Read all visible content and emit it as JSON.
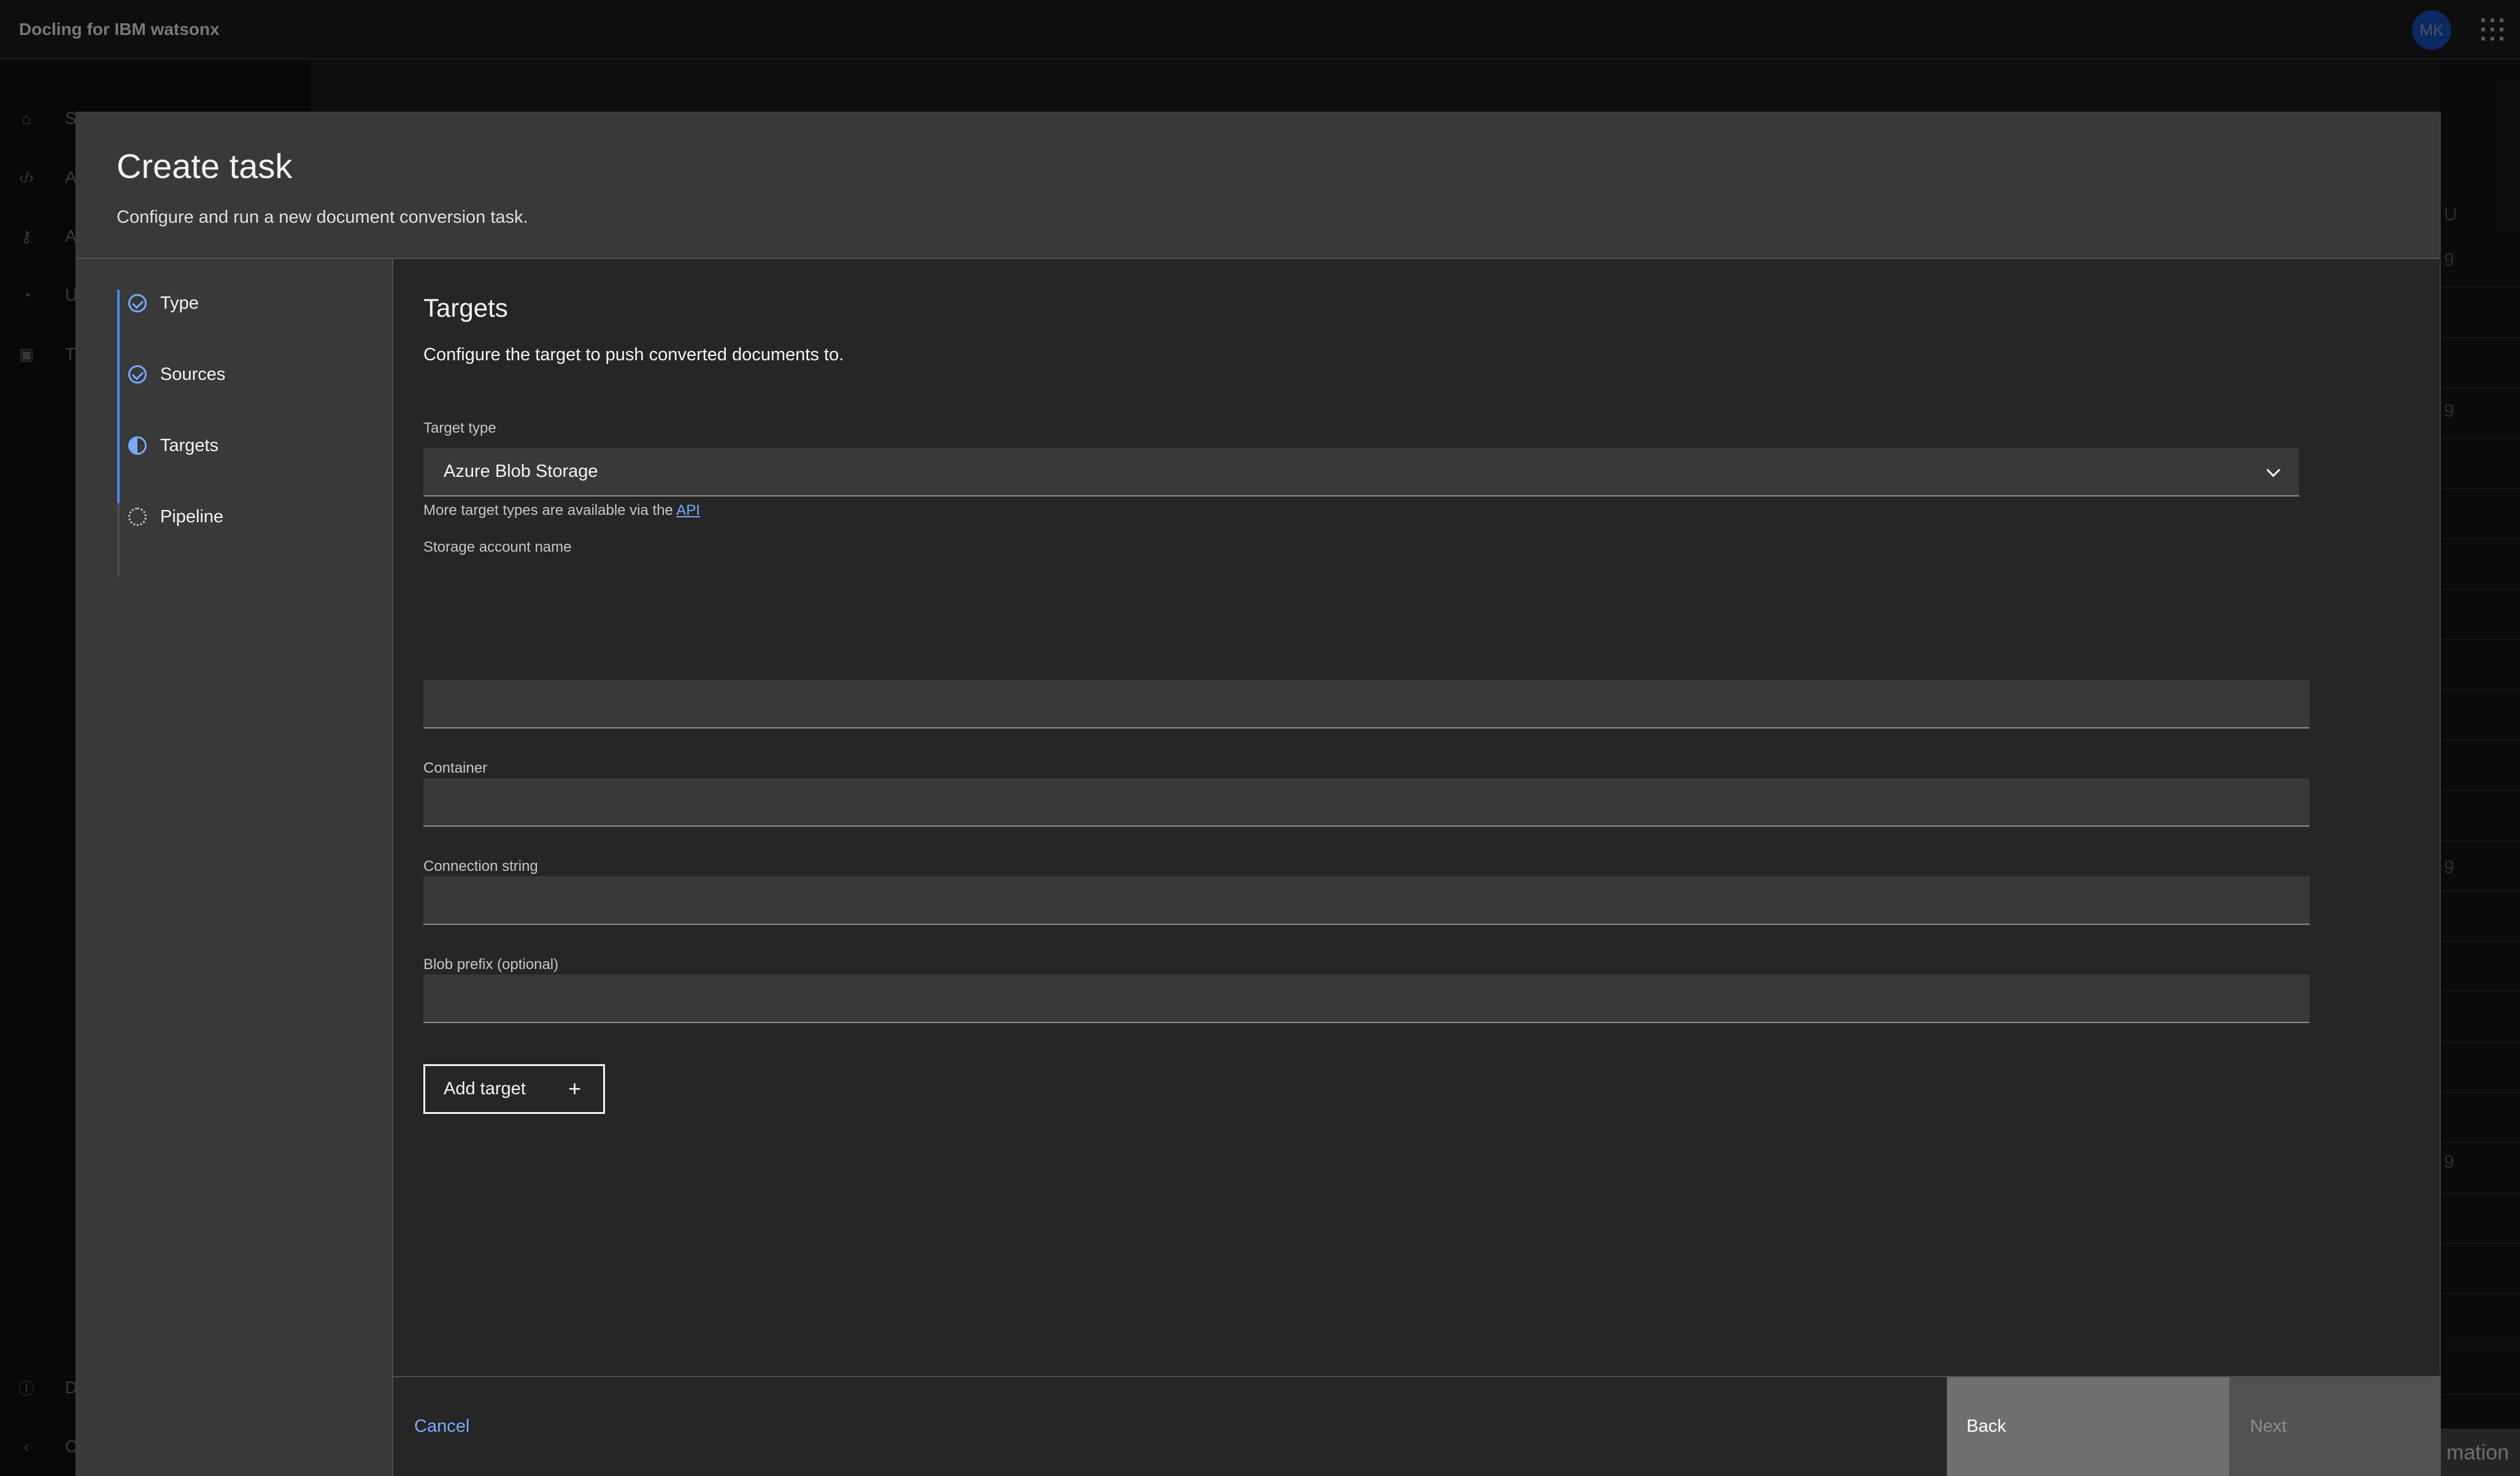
{
  "header": {
    "app_title": "Docling for IBM watsonx",
    "avatar_initials": "MK"
  },
  "background": {
    "sidenav_items": [
      {
        "label": "Start",
        "icon": "home-icon"
      },
      {
        "label": "A",
        "icon": "code-icon"
      },
      {
        "label": "A",
        "icon": "key-icon"
      },
      {
        "label": "U",
        "icon": "gauge-icon"
      },
      {
        "label": "T",
        "icon": "clipboard-icon"
      }
    ],
    "sidenav_bottom": [
      {
        "label": "D",
        "icon": "info-icon"
      },
      {
        "label": "C",
        "icon": "chevron-left-icon"
      }
    ],
    "right_column_header": "U",
    "right_marks": [
      "9",
      "9",
      "9",
      "9"
    ],
    "info_text": "mation"
  },
  "modal": {
    "title": "Create task",
    "subtitle": "Configure and run a new document conversion task.",
    "steps": [
      {
        "label": "Type",
        "status": "complete"
      },
      {
        "label": "Sources",
        "status": "complete"
      },
      {
        "label": "Targets",
        "status": "current"
      },
      {
        "label": "Pipeline",
        "status": "incomplete"
      }
    ],
    "section": {
      "title": "Targets",
      "description": "Configure the target to push converted documents to."
    },
    "target_type": {
      "label": "Target type",
      "value": "Azure Blob Storage",
      "helper_prefix": "More target types are available via the",
      "helper_link": "API"
    },
    "fields": [
      {
        "label": "Storage account name",
        "value": ""
      },
      {
        "label": "Container",
        "value": ""
      },
      {
        "label": "Connection string",
        "value": ""
      },
      {
        "label": "Blob prefix (optional)",
        "value": ""
      }
    ],
    "add_target_label": "Add target",
    "footer": {
      "cancel": "Cancel",
      "back": "Back",
      "next": "Next"
    }
  },
  "colors": {
    "accent": "#78a9ff",
    "primary": "#0f62fe",
    "modal_bg": "#262626",
    "header_bg": "#393939"
  }
}
